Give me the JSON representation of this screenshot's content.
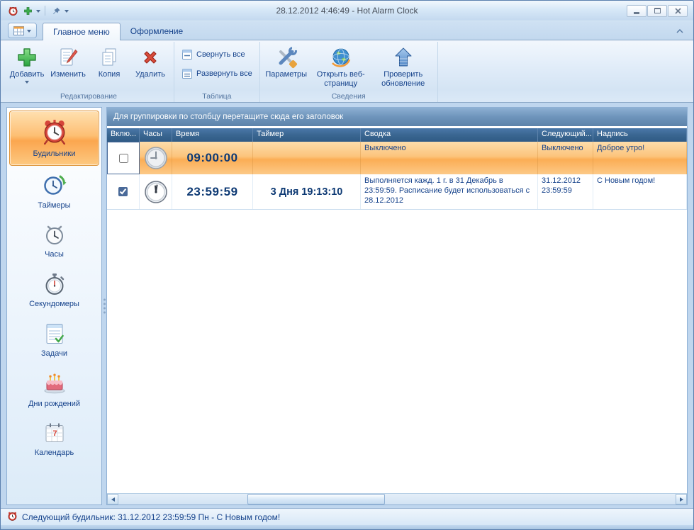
{
  "window": {
    "title": "28.12.2012 4:46:49 - Hot Alarm Clock"
  },
  "tabs": {
    "items": [
      {
        "label": "Главное меню"
      },
      {
        "label": "Оформление"
      }
    ]
  },
  "ribbon": {
    "groups": [
      {
        "label": "Редактирование"
      },
      {
        "label": "Таблица"
      },
      {
        "label": "Сведения"
      }
    ],
    "buttons": {
      "add": "Добавить",
      "edit": "Изменить",
      "copy": "Копия",
      "delete": "Удалить",
      "collapse_all": "Свернуть все",
      "expand_all": "Развернуть все",
      "parameters": "Параметры",
      "open_web": "Открыть веб-страницу",
      "check_update": "Проверить обновление"
    }
  },
  "sidebar": {
    "calendar_day": "7",
    "items": [
      {
        "label": "Будильники",
        "icon": "alarm-clock",
        "selected": true
      },
      {
        "label": "Таймеры",
        "icon": "timer"
      },
      {
        "label": "Часы",
        "icon": "clock"
      },
      {
        "label": "Секундомеры",
        "icon": "stopwatch"
      },
      {
        "label": "Задачи",
        "icon": "tasks"
      },
      {
        "label": "Дни рождений",
        "icon": "birthday-cake"
      },
      {
        "label": "Календарь",
        "icon": "calendar"
      }
    ]
  },
  "grid": {
    "group_hint": "Для группировки по столбцу перетащите сюда его заголовок",
    "columns": [
      "Вклю...",
      "Часы",
      "Время",
      "Таймер",
      "Сводка",
      "Следующий...",
      "Надпись"
    ],
    "rows": [
      {
        "enabled": false,
        "time": "09:00:00",
        "timer": "",
        "summary": "Выключено",
        "next": "Выключено",
        "caption": "Доброе утро!"
      },
      {
        "enabled": true,
        "time": "23:59:59",
        "timer": "3 Дня 19:13:10",
        "summary": "Выполняется кажд. 1 г. в 31 Декабрь в 23:59:59. Расписание будет использоваться с 28.12.2012",
        "next": "31.12.2012 23:59:59",
        "caption": "С Новым годом!"
      }
    ]
  },
  "statusbar": {
    "text": "Следующий будильник: 31.12.2012 23:59:59 Пн - С Новым годом!"
  },
  "colors": {
    "selection_orange": "#fbad55",
    "header_blue": "#39658f",
    "group_bar_blue": "#6e94bb",
    "text_navy": "#15428b",
    "add_green": "#27a33d",
    "delete_red": "#d94c3c"
  }
}
